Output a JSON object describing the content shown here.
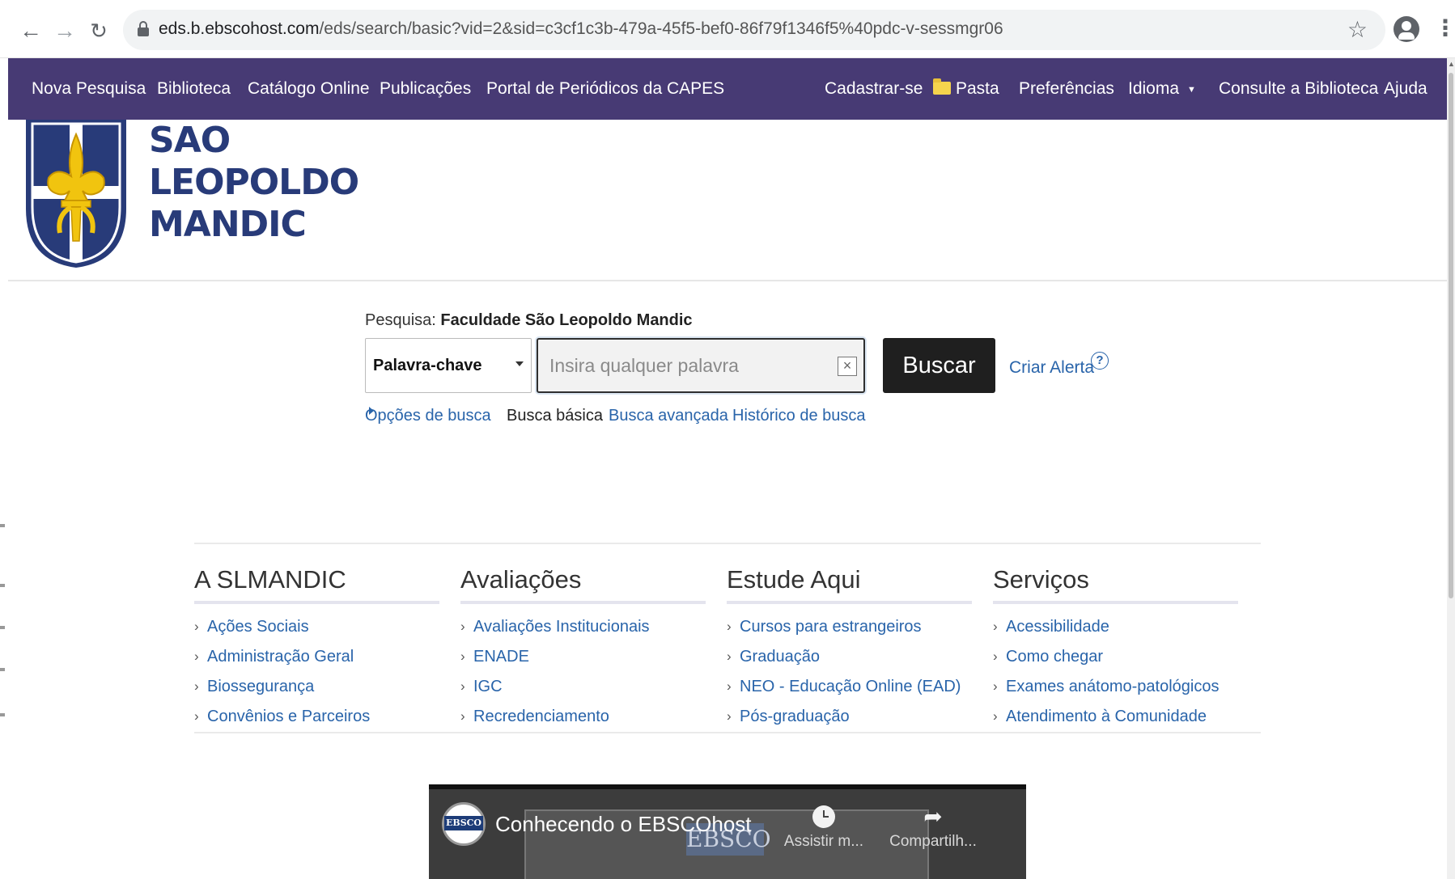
{
  "browser": {
    "url_host": "eds.b.ebscohost.com",
    "url_path": "/eds/search/basic?vid=2&sid=c3cf1c3b-479a-45f5-bef0-86f79f1346f5%40pdc-v-sessmgr06"
  },
  "topnav": {
    "left": [
      "Nova Pesquisa",
      "Biblioteca",
      "Catálogo Online",
      "Publicações",
      "Portal de Periódicos da CAPES"
    ],
    "register": "Cadastrar-se",
    "folder": "Pasta",
    "preferences": "Preferências",
    "language": "Idioma",
    "consult": "Consulte a Biblioteca",
    "help": "Ajuda"
  },
  "logo": {
    "line1": "SAO",
    "line2": "LEOPOLDO",
    "line3": "MANDIC",
    "colors": {
      "navy": "#283b79",
      "gold": "#f1c40f"
    }
  },
  "search": {
    "label": "Pesquisa:",
    "institution": "Faculdade São Leopoldo Mandic",
    "field_selected": "Palavra-chave",
    "placeholder": "Insira qualquer palavra",
    "value": "",
    "button": "Buscar",
    "alert": "Criar Alerta",
    "help": "?",
    "options": "Opções de busca",
    "basic": "Busca básica",
    "advanced": "Busca avançada",
    "history": "Histórico de busca"
  },
  "footer": {
    "columns": [
      {
        "title": "A SLMANDIC",
        "items": [
          "Ações Sociais",
          "Administração Geral",
          "Biossegurança",
          "Convênios e Parceiros"
        ]
      },
      {
        "title": "Avaliações",
        "items": [
          "Avaliações Institucionais",
          "ENADE",
          "IGC",
          "Recredenciamento"
        ]
      },
      {
        "title": "Estude Aqui",
        "items": [
          "Cursos para estrangeiros",
          "Graduação",
          "NEO - Educação Online (EAD)",
          "Pós-graduação"
        ]
      },
      {
        "title": "Serviços",
        "items": [
          "Acessibilidade",
          "Como chegar",
          "Exames anátomo-patológicos",
          "Atendimento à Comunidade"
        ]
      }
    ]
  },
  "video": {
    "channel": "EBSCO",
    "title": "Conhecendo o EBSCOhost",
    "bg_logo": "EBSCO",
    "watch_later": "Assistir m...",
    "share": "Compartilh..."
  },
  "colors": {
    "nav_bg": "#473a74",
    "link": "#2964aa",
    "button_bg": "#1f1f1f"
  }
}
